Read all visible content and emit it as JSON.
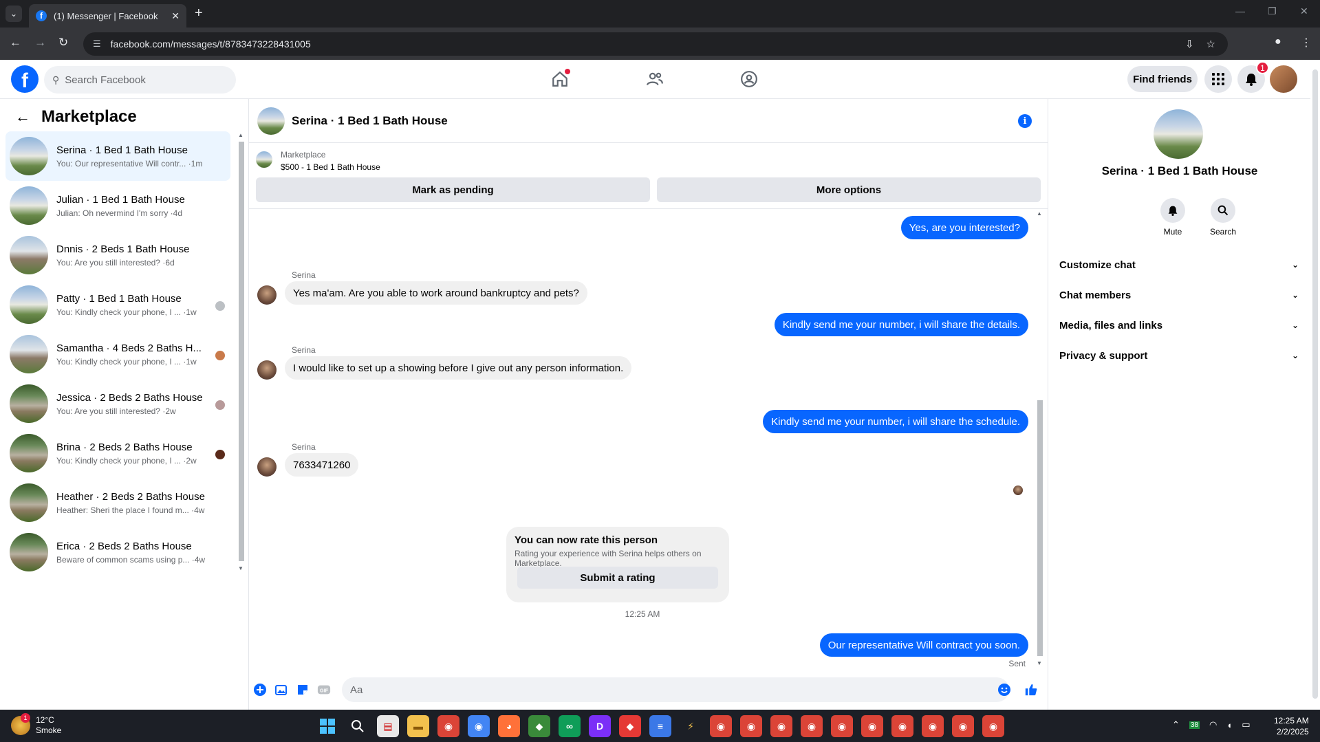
{
  "browser": {
    "tab_title": "(1) Messenger | Facebook",
    "url": "facebook.com/messages/t/8783473228431005"
  },
  "header": {
    "search_placeholder": "Search Facebook",
    "find_friends": "Find friends",
    "notification_count": "1"
  },
  "left": {
    "title": "Marketplace",
    "conversations": [
      {
        "name": "Serina · 1 Bed 1 Bath House",
        "preview": "You: Our representative Will contr... ·1m"
      },
      {
        "name": "Julian · 1 Bed 1 Bath House",
        "preview": "Julian: Oh nevermind I'm sorry ·4d"
      },
      {
        "name": "Dnnis · 2 Beds 1 Bath House",
        "preview": "You: Are you still interested? ·6d"
      },
      {
        "name": "Patty · 1 Bed 1 Bath House",
        "preview": "You: Kindly check your phone, I ... ·1w"
      },
      {
        "name": "Samantha · 4 Beds 2 Baths H...",
        "preview": "You: Kindly check your phone, I ... ·1w"
      },
      {
        "name": "Jessica · 2 Beds 2 Baths House",
        "preview": "You: Are you still interested? ·2w"
      },
      {
        "name": "Brina · 2 Beds 2 Baths House",
        "preview": "You: Kindly check your phone, I ... ·2w"
      },
      {
        "name": "Heather · 2 Beds 2 Baths House",
        "preview": "Heather: Sheri the place I found m... ·4w"
      },
      {
        "name": "Erica · 2 Beds 2 Baths House",
        "preview": "Beware of common scams using p... ·4w"
      }
    ]
  },
  "chat": {
    "title": "Serina · 1 Bed 1 Bath House",
    "listing_label": "Marketplace",
    "listing_detail": "$500 - 1 Bed 1 Bath House",
    "mark_pending": "Mark as pending",
    "more_options": "More options",
    "messages": {
      "out1": "Yes, are you interested?",
      "sender": "Serina",
      "in1": "Yes ma'am. Are you able to work around bankruptcy and pets?",
      "out2": "Kindly send me your number, i will share the details.",
      "in2": "I would like to set up a showing before I give out any person information.",
      "out3": "Kindly send me your number, i will share the schedule.",
      "in3": "7633471260",
      "out4": "Our representative Will contract you soon."
    },
    "rate_title": "You can now rate this person",
    "rate_sub": "Rating your experience with Serina helps others on Marketplace.",
    "rate_button": "Submit a rating",
    "timestamp": "12:25 AM",
    "sent": "Sent",
    "composer_placeholder": "Aa"
  },
  "right": {
    "name": "Serina · 1 Bed 1 Bath House",
    "mute": "Mute",
    "search": "Search",
    "sections": [
      "Customize chat",
      "Chat members",
      "Media, files and links",
      "Privacy & support"
    ]
  },
  "taskbar": {
    "temp": "12°C",
    "weather": "Smoke",
    "weather_badge": "1",
    "time": "12:25 AM",
    "date": "2/2/2025",
    "tray_badge": "38"
  },
  "colors": {
    "accent": "#0866ff",
    "notification": "#e41e3f",
    "active_conv": "#ebf5ff"
  }
}
